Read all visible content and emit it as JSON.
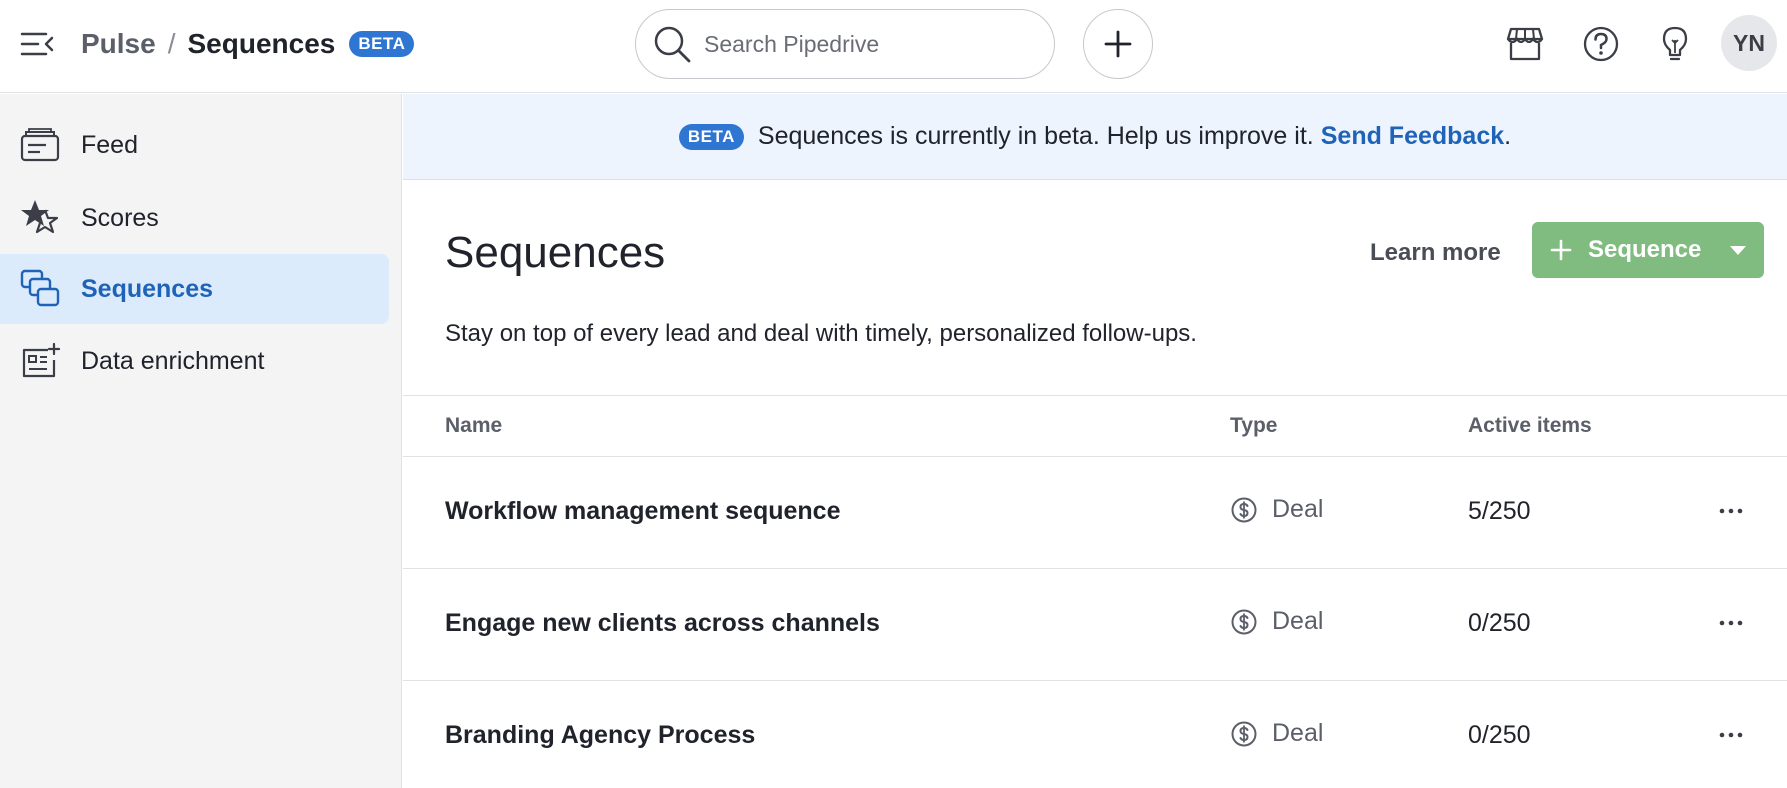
{
  "header": {
    "breadcrumb_parent": "Pulse",
    "breadcrumb_separator": "/",
    "breadcrumb_current": "Sequences",
    "beta_badge": "BETA",
    "search_placeholder": "Search Pipedrive",
    "avatar_initials": "YN",
    "icons": [
      "menu-collapse-icon",
      "search-icon",
      "plus-icon",
      "marketplace-icon",
      "help-icon",
      "lightbulb-icon"
    ]
  },
  "sidebar": {
    "items": [
      {
        "label": "Feed",
        "icon": "feed-icon",
        "active": false
      },
      {
        "label": "Scores",
        "icon": "scores-icon",
        "active": false
      },
      {
        "label": "Sequences",
        "icon": "sequences-icon",
        "active": true
      },
      {
        "label": "Data enrichment",
        "icon": "data-enrichment-icon",
        "active": false
      }
    ]
  },
  "banner": {
    "badge": "BETA",
    "message": "Sequences is currently in beta. Help us improve it.",
    "link_text": "Send Feedback",
    "trailing": "."
  },
  "main": {
    "title": "Sequences",
    "learn_more": "Learn more",
    "add_button": "Sequence",
    "subtitle": "Stay on top of every lead and deal with timely, personalized follow-ups."
  },
  "table": {
    "columns": [
      "Name",
      "Type",
      "Active items"
    ],
    "rows": [
      {
        "name": "Workflow management sequence",
        "type": "Deal",
        "active": "5/250"
      },
      {
        "name": "Engage new clients across channels",
        "type": "Deal",
        "active": "0/250"
      },
      {
        "name": "Branding Agency Process",
        "type": "Deal",
        "active": "0/250"
      }
    ]
  },
  "colors": {
    "accent_blue": "#2f76d2",
    "link_blue": "#1f63b8",
    "primary_green": "#80bb80",
    "sidebar_bg": "#f4f4f5",
    "active_item_bg": "#dbebfb",
    "banner_bg": "#edf4fe"
  }
}
